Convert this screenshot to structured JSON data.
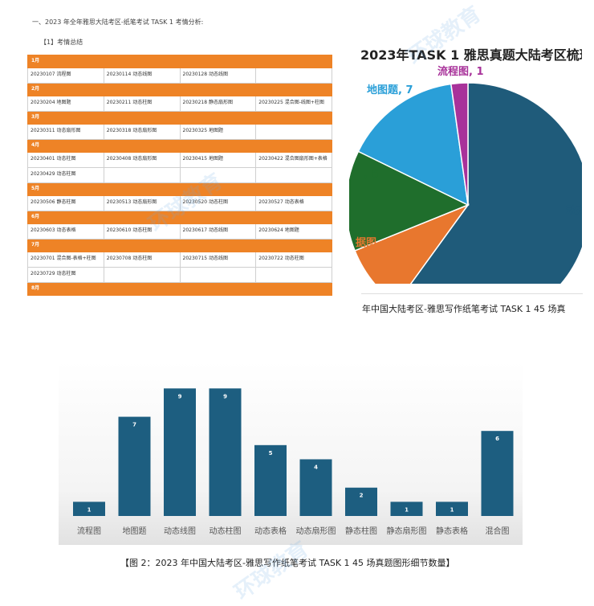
{
  "doc": {
    "heading": "一、2023 年全年雅思大陆考区-纸笔考试 TASK 1 考情分析:",
    "subheading": "【1】考情总结"
  },
  "schedule": [
    {
      "month": "1月",
      "rows": [
        [
          "20230107 流程图",
          "20230114 动态线图",
          "20230128 动态线图",
          ""
        ]
      ]
    },
    {
      "month": "2月",
      "rows": [
        [
          "20230204 地图题",
          "20230211 动态柱图",
          "20230218 静态扇形图",
          "20230225 混合图-线图+柱图"
        ]
      ]
    },
    {
      "month": "3月",
      "rows": [
        [
          "20230311 动态扇形图",
          "20230318 动态扇形图",
          "20230325 地图题",
          ""
        ]
      ]
    },
    {
      "month": "4月",
      "rows": [
        [
          "20230401 动态柱图",
          "20230408 动态扇形图",
          "20230415 地图题",
          "20230422 混合图扇形图+表格"
        ],
        [
          "20230429 动态柱图",
          "",
          "",
          ""
        ]
      ]
    },
    {
      "month": "5月",
      "rows": [
        [
          "20230506 静态柱图",
          "20230513 动态扇形图",
          "20230520 动态柱图",
          "20230527 动态表格"
        ]
      ]
    },
    {
      "month": "6月",
      "rows": [
        [
          "20230603 动态表格",
          "20230610 动态柱图",
          "20230617 动态线图",
          "20230624 地图题"
        ]
      ]
    },
    {
      "month": "7月",
      "rows": [
        [
          "20230701 混合图-表格+柱图",
          "20230708 动态柱图",
          "20230715 动态线图",
          "20230722 动态柱图"
        ],
        [
          "20230729 动态柱图",
          "",
          "",
          ""
        ]
      ]
    },
    {
      "month": "8月",
      "rows": []
    }
  ],
  "pie": {
    "title": "2023年TASK 1 雅思真题大陆考区梳理",
    "caption": "年中国大陆考区-雅思写作纸笔考试 TASK 1 45 场真",
    "labels": [
      {
        "text": "流程图, 1",
        "color": "#a8329a"
      },
      {
        "text": "地图题, 7",
        "color": "#2a9fd8"
      },
      {
        "text": ", 6",
        "color": "#1f6e2c"
      },
      {
        "text": "据图, 4",
        "color": "#e8772e"
      },
      {
        "text": "动态",
        "color": "#1f5b7a"
      }
    ]
  },
  "bar": {
    "caption": "【图 2：2023 年中国大陆考区-雅思写作纸笔考试 TASK 1 45 场真题图形细节数量】"
  },
  "watermark": {
    "text": "环球教育"
  },
  "chart_data": [
    {
      "type": "pie",
      "title": "2023年TASK 1 雅思真题大陆考区梳理",
      "categories": [
        "流程图",
        "地图题",
        "动态柱图",
        "动态扇形图",
        "动态线图"
      ],
      "values": [
        1,
        7,
        6,
        4,
        27
      ],
      "colors": [
        "#a8329a",
        "#2a9fd8",
        "#1f6e2c",
        "#e8772e",
        "#1f5b7a"
      ],
      "visible_labels": [
        "流程图, 1",
        "地图题, 7",
        ", 6",
        "据图, 4",
        "动态"
      ]
    },
    {
      "type": "bar",
      "categories": [
        "流程图",
        "地图题",
        "动态线图",
        "动态柱图",
        "动态表格",
        "动态扇形图",
        "静态柱图",
        "静态扇形图",
        "静态表格",
        "混合图"
      ],
      "values": [
        1,
        7,
        9,
        9,
        5,
        4,
        2,
        1,
        1,
        6
      ],
      "ylim": [
        0,
        10
      ],
      "bar_color": "#1d5e80",
      "grid": false
    }
  ]
}
